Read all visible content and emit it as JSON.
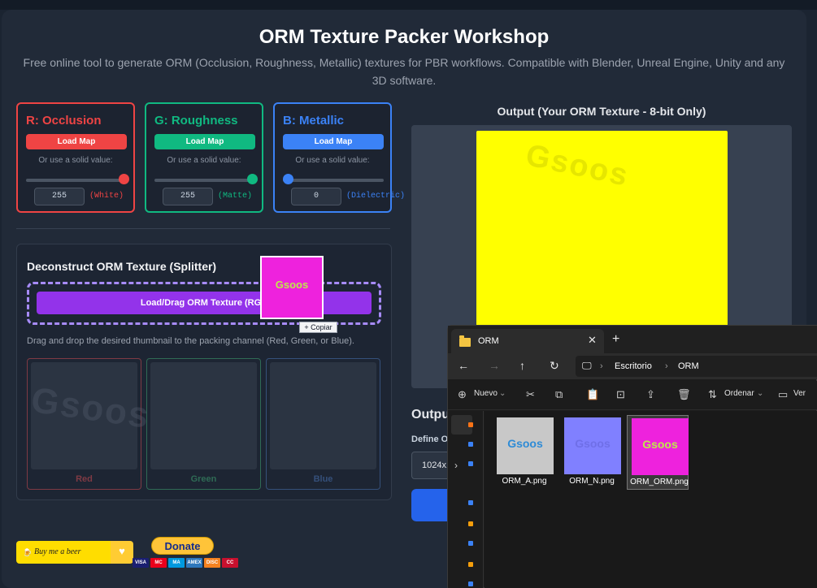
{
  "header": {
    "title": "ORM Texture Packer Workshop",
    "subtitle": "Free online tool to generate ORM (Occlusion, Roughness, Metallic) textures for PBR workflows. Compatible with Blender, Unreal Engine, Unity and any 3D software."
  },
  "channels": [
    {
      "title": "R: Occlusion",
      "load_label": "Load Map",
      "solid_label": "Or use a solid value:",
      "value": "255",
      "desc": "(White)",
      "color": "#ef4444",
      "slider_fraction": 1.0
    },
    {
      "title": "G: Roughness",
      "load_label": "Load Map",
      "solid_label": "Or use a solid value:",
      "value": "255",
      "desc": "(Matte)",
      "color": "#10b981",
      "slider_fraction": 1.0
    },
    {
      "title": "B: Metallic",
      "load_label": "Load Map",
      "solid_label": "Or use a solid value:",
      "value": "0",
      "desc": "(Dielectric)",
      "color": "#3b82f6",
      "slider_fraction": 0.0
    }
  ],
  "splitter": {
    "title": "Deconstruct ORM Texture (Splitter)",
    "button_label": "Load/Drag ORM Texture (RGB",
    "hint": "Drag and drop the desired thumbnail to the packing channel (Red, Green, or Blue).",
    "slots": [
      {
        "label": "Red",
        "color": "#7f3a44"
      },
      {
        "label": "Green",
        "color": "#2f6b55"
      },
      {
        "label": "Blue",
        "color": "#35507a"
      }
    ],
    "watermark": "Gsoos"
  },
  "drag": {
    "thumb_text": "Gsoos",
    "copy_tip": "+ Copiar"
  },
  "output": {
    "title": "Output (Your ORM Texture - 8-bit Only)",
    "watermark": "Gsoos",
    "settings_title": "Outpu",
    "define_label": "Define O",
    "resolution": "1024x1"
  },
  "support": {
    "bmc_label": "Buy me a beer",
    "donate_label": "Donate",
    "cards": [
      "VISA",
      "MC",
      "MA",
      "AMEX",
      "DISC",
      "CC"
    ]
  },
  "explorer": {
    "tab_title": "ORM",
    "tab_close": "✕",
    "new_tab": "+",
    "breadcrumb": [
      "Escritorio",
      "ORM"
    ],
    "toolbar": {
      "new_label": "Nuevo",
      "sort_label": "Ordenar",
      "view_label": "Ver"
    },
    "files": [
      {
        "name": "ORM_A.png",
        "color": "#c8c8c8",
        "text_color": "#2e8bd6",
        "label": "Gsoos"
      },
      {
        "name": "ORM_N.png",
        "color": "#8080ff",
        "text_color": "#6f6fe8",
        "label": "Gsoos"
      },
      {
        "name": "ORM_ORM.png",
        "color": "#ee22dd",
        "text_color": "#bfe84c",
        "label": "Gsoos"
      }
    ]
  }
}
